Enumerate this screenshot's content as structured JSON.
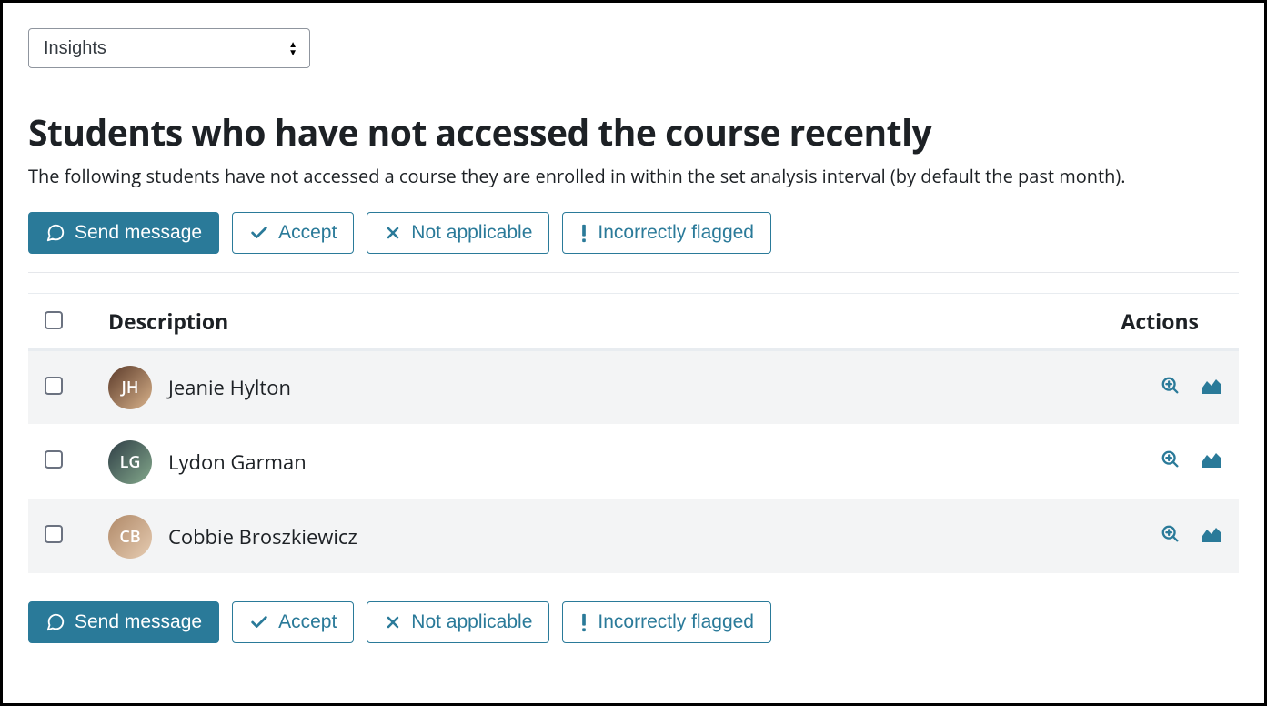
{
  "dropdown": {
    "selected": "Insights"
  },
  "page": {
    "title": "Students who have not accessed the course recently",
    "subtitle": "The following students have not accessed a course they are enrolled in within the set analysis interval (by default the past month)."
  },
  "actions": {
    "send_message": "Send message",
    "accept": "Accept",
    "not_applicable": "Not applicable",
    "incorrectly_flagged": "Incorrectly flagged"
  },
  "table": {
    "headers": {
      "description": "Description",
      "actions": "Actions"
    },
    "rows": [
      {
        "name": "Jeanie Hylton",
        "initials": "JH",
        "avatar_class": "jh"
      },
      {
        "name": "Lydon Garman",
        "initials": "LG",
        "avatar_class": "lg"
      },
      {
        "name": "Cobbie Broszkiewicz",
        "initials": "CB",
        "avatar_class": "cb"
      }
    ]
  },
  "icons": {
    "message": "message-icon",
    "check": "check-icon",
    "x": "x-icon",
    "exclaim": "exclaim-icon",
    "zoom": "zoom-icon",
    "chart": "chart-icon"
  },
  "colors": {
    "primary": "#2a7a99"
  }
}
